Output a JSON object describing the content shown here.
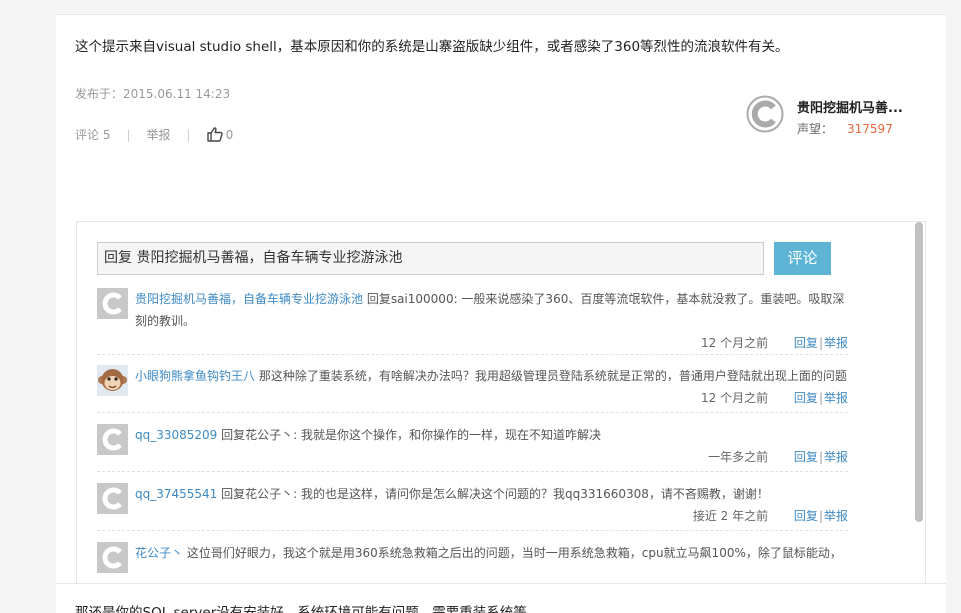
{
  "answer": {
    "text": "这个提示来自visual studio shell，基本原因和你的系统是山寨盗版缺少组件，或者感染了360等烈性的流浪软件有关。",
    "publish_label": "发布于：2015.06.11 14:23",
    "comment_count_label": "评论 5",
    "report_label": "举报",
    "like_count": "0",
    "separator": "|"
  },
  "author": {
    "name": "贵阳挖掘机马善...",
    "reputation_label": "声望：",
    "reputation_value": "317597"
  },
  "comments_panel": {
    "reply_input_value": "回复 贵阳挖掘机马善福，自备车辆专业挖游泳池",
    "reply_button_label": "评论",
    "items": [
      {
        "username": "贵阳挖掘机马善福，自备车辆专业挖游泳池",
        "text": " 回复sai100000: 一般来说感染了360、百度等流氓软件，基本就没救了。重装吧。吸取深刻的教训。",
        "time": "12 个月之前",
        "reply": "回复",
        "report": "举报",
        "avatar": "c-logo-avatar"
      },
      {
        "username": "小眼狗熊拿鱼钩钓王八",
        "text": " 那这种除了重装系统，有啥解决办法吗？我用超级管理员登陆系统就是正常的，普通用户登陆就出现上面的问题",
        "time": "12 个月之前",
        "reply": "回复",
        "report": "举报",
        "avatar": "monkey-avatar"
      },
      {
        "username": "qq_33085209",
        "text": " 回复花公子丶: 我就是你这个操作，和你操作的一样，现在不知道咋解决",
        "time": "一年多之前",
        "reply": "回复",
        "report": "举报",
        "avatar": "c-logo-avatar"
      },
      {
        "username": "qq_37455541",
        "text": " 回复花公子丶: 我的也是这样，请问你是怎么解决这个问题的？我qq331660308，请不吝赐教，谢谢！",
        "time": "接近 2 年之前",
        "reply": "回复",
        "report": "举报",
        "avatar": "c-logo-avatar"
      },
      {
        "username": "花公子丶",
        "text": "  这位哥们好眼力，我这个就是用360系统急救箱之后出的问题，当时一用系统急救箱，cpu就立马飙100%，除了鼠标能动，",
        "avatar": "c-logo-avatar"
      }
    ]
  },
  "next_answer": {
    "text": "那还是你的SQL server没有安装好，系统环境可能有问题，需要重装系统等"
  },
  "colors": {
    "link_blue": "#3d8ac5",
    "button_blue": "#5eb4d4",
    "reputation_orange": "#e8683c"
  }
}
